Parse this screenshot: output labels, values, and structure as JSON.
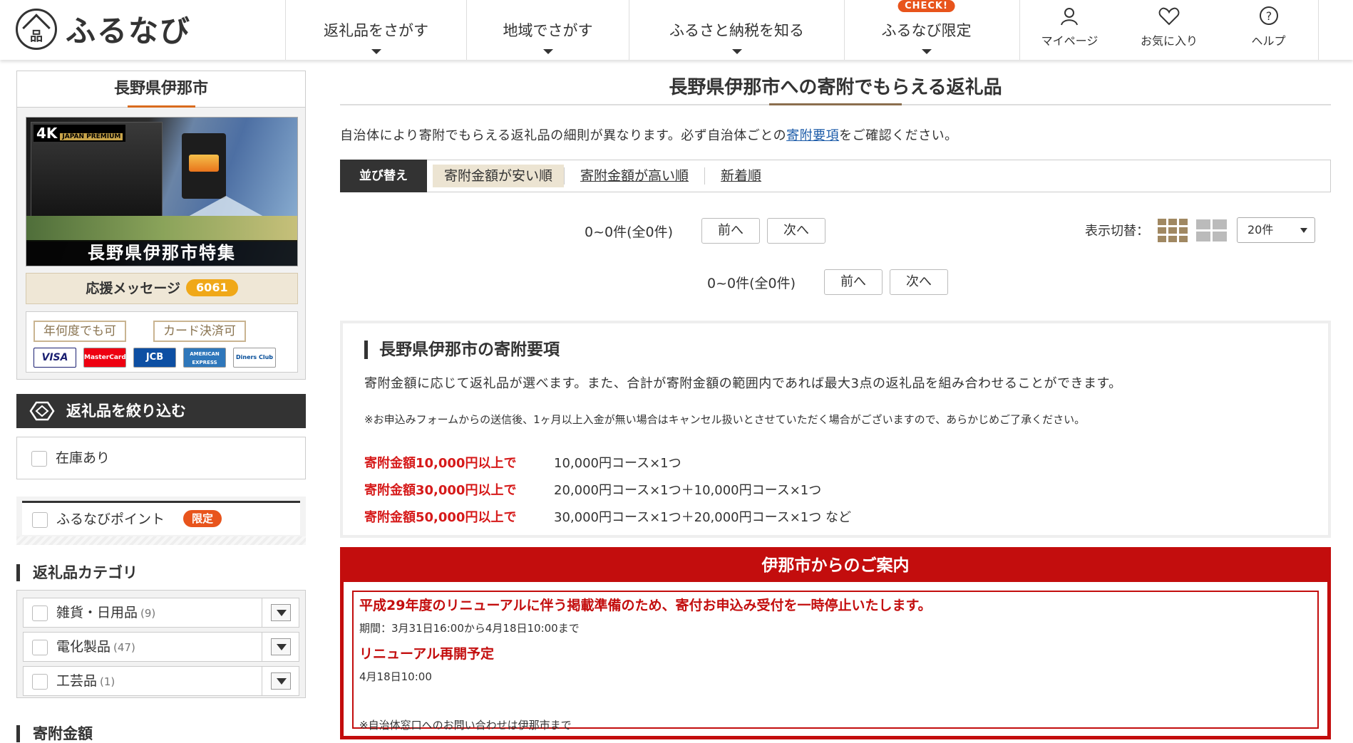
{
  "header": {
    "logo_mark": "品",
    "logo_text": "ふるなび",
    "nav": [
      {
        "label": "返礼品をさがす"
      },
      {
        "label": "地域でさがす"
      },
      {
        "label": "ふるさと納税を知る"
      },
      {
        "label": "ふるなび限定",
        "badge": "CHECK!"
      }
    ],
    "util": [
      {
        "label": "マイページ",
        "icon": "user-icon"
      },
      {
        "label": "お気に入り",
        "icon": "heart-icon"
      },
      {
        "label": "ヘルプ",
        "icon": "help-icon"
      }
    ]
  },
  "sidebar": {
    "municipality": "長野県伊那市",
    "banner": {
      "badge": "4K",
      "badge_sub": "JAPAN PREMIUM",
      "title": "長野県伊那市特集"
    },
    "support_message": {
      "label": "応援メッセージ",
      "count": "6061"
    },
    "tags": [
      "年何度でも可",
      "カード決済可"
    ],
    "cards": [
      "VISA",
      "MasterCard",
      "JCB",
      "AMERICAN EXPRESS",
      "Diners Club"
    ],
    "filter_title": "返礼品を絞り込む",
    "in_stock": "在庫あり",
    "point": {
      "label": "ふるなびポイント",
      "badge": "限定"
    },
    "category_title": "返礼品カテゴリ",
    "categories": [
      {
        "label": "雑貨・日用品",
        "count": "(9)"
      },
      {
        "label": "電化製品",
        "count": "(47)"
      },
      {
        "label": "工芸品",
        "count": "(1)"
      }
    ],
    "amount_title": "寄附金額"
  },
  "main": {
    "title": "長野県伊那市への寄附でもらえる返礼品",
    "intro_before": "自治体により寄附でもらえる返礼品の細則が異なります。必ず自治体ごとの",
    "intro_link": "寄附要項",
    "intro_after": "をご確認ください。",
    "sort": {
      "label": "並び替え",
      "options": [
        "寄附金額が安い順",
        "寄附金額が高い順",
        "新着順"
      ]
    },
    "pager": {
      "count": "0~0件(全0件)",
      "prev": "前へ",
      "next": "次へ"
    },
    "view_switch": {
      "label": "表示切替：",
      "per_page": "20件"
    },
    "requirements": {
      "title": "長野県伊那市の寄附要項",
      "text": "寄附金額に応じて返礼品が選べます。また、合計が寄附金額の範囲内であれば最大3点の返礼品を組み合わせることができます。",
      "note": "※お申込みフォームからの送信後、1ヶ月以上入金が無い場合はキャンセル扱いとさせていただく場合がございますので、あらかじめご了承ください。",
      "rows": [
        {
          "amount": "寄附金額10,000円以上で",
          "course": "10,000円コース×1つ"
        },
        {
          "amount": "寄附金額30,000円以上で",
          "course": "20,000円コース×1つ＋10,000円コース×1つ"
        },
        {
          "amount": "寄附金額50,000円以上で",
          "course": "30,000円コース×1つ＋20,000円コース×1つ など"
        }
      ]
    },
    "notice": {
      "title": "伊那市からのご案内",
      "line1": "平成29年度のリニューアルに伴う掲載準備のため、寄付お申込み受付を一時停止いたします。",
      "line2": "期間：3月31日16:00から4月18日10:00まで",
      "line3": "リニューアル再開予定",
      "line4": "4月18日10:00",
      "line5": "※自治体窓口へのお問い合わせは伊那市まで"
    }
  }
}
